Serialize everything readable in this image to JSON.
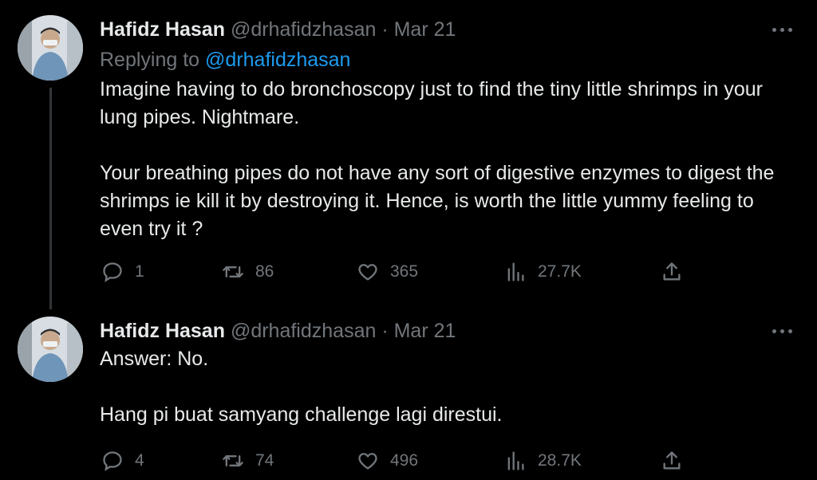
{
  "tweets": [
    {
      "name": "Hafidz Hasan",
      "handle": "@drhafidzhasan",
      "separator": "·",
      "date": "Mar 21",
      "replying_to_label": "Replying to",
      "replying_to_handle": "@drhafidzhasan",
      "paragraphs": [
        "Imagine having to do bronchoscopy just to find the tiny little shrimps in your lung pipes. Nightmare.",
        "Your breathing pipes do not have any sort of digestive enzymes to digest the shrimps ie kill it by destroying it. Hence, is worth the little yummy feeling to even try it ?"
      ],
      "stats": {
        "replies": "1",
        "retweets": "86",
        "likes": "365",
        "views": "27.7K"
      }
    },
    {
      "name": "Hafidz Hasan",
      "handle": "@drhafidzhasan",
      "separator": "·",
      "date": "Mar 21",
      "paragraphs": [
        "Answer: No.",
        "Hang pi buat samyang challenge lagi direstui."
      ],
      "stats": {
        "replies": "4",
        "retweets": "74",
        "likes": "496",
        "views": "28.7K"
      }
    }
  ],
  "icons": {
    "more": "more-horizontal-icon",
    "reply": "reply-bubble-icon",
    "retweet": "retweet-icon",
    "like": "heart-icon",
    "views": "analytics-bars-icon",
    "share": "share-upload-icon"
  },
  "colors": {
    "background": "#000000",
    "text": "#e7e9ea",
    "muted": "#71767b",
    "link": "#1d9bf0",
    "thread_line": "#333639"
  }
}
